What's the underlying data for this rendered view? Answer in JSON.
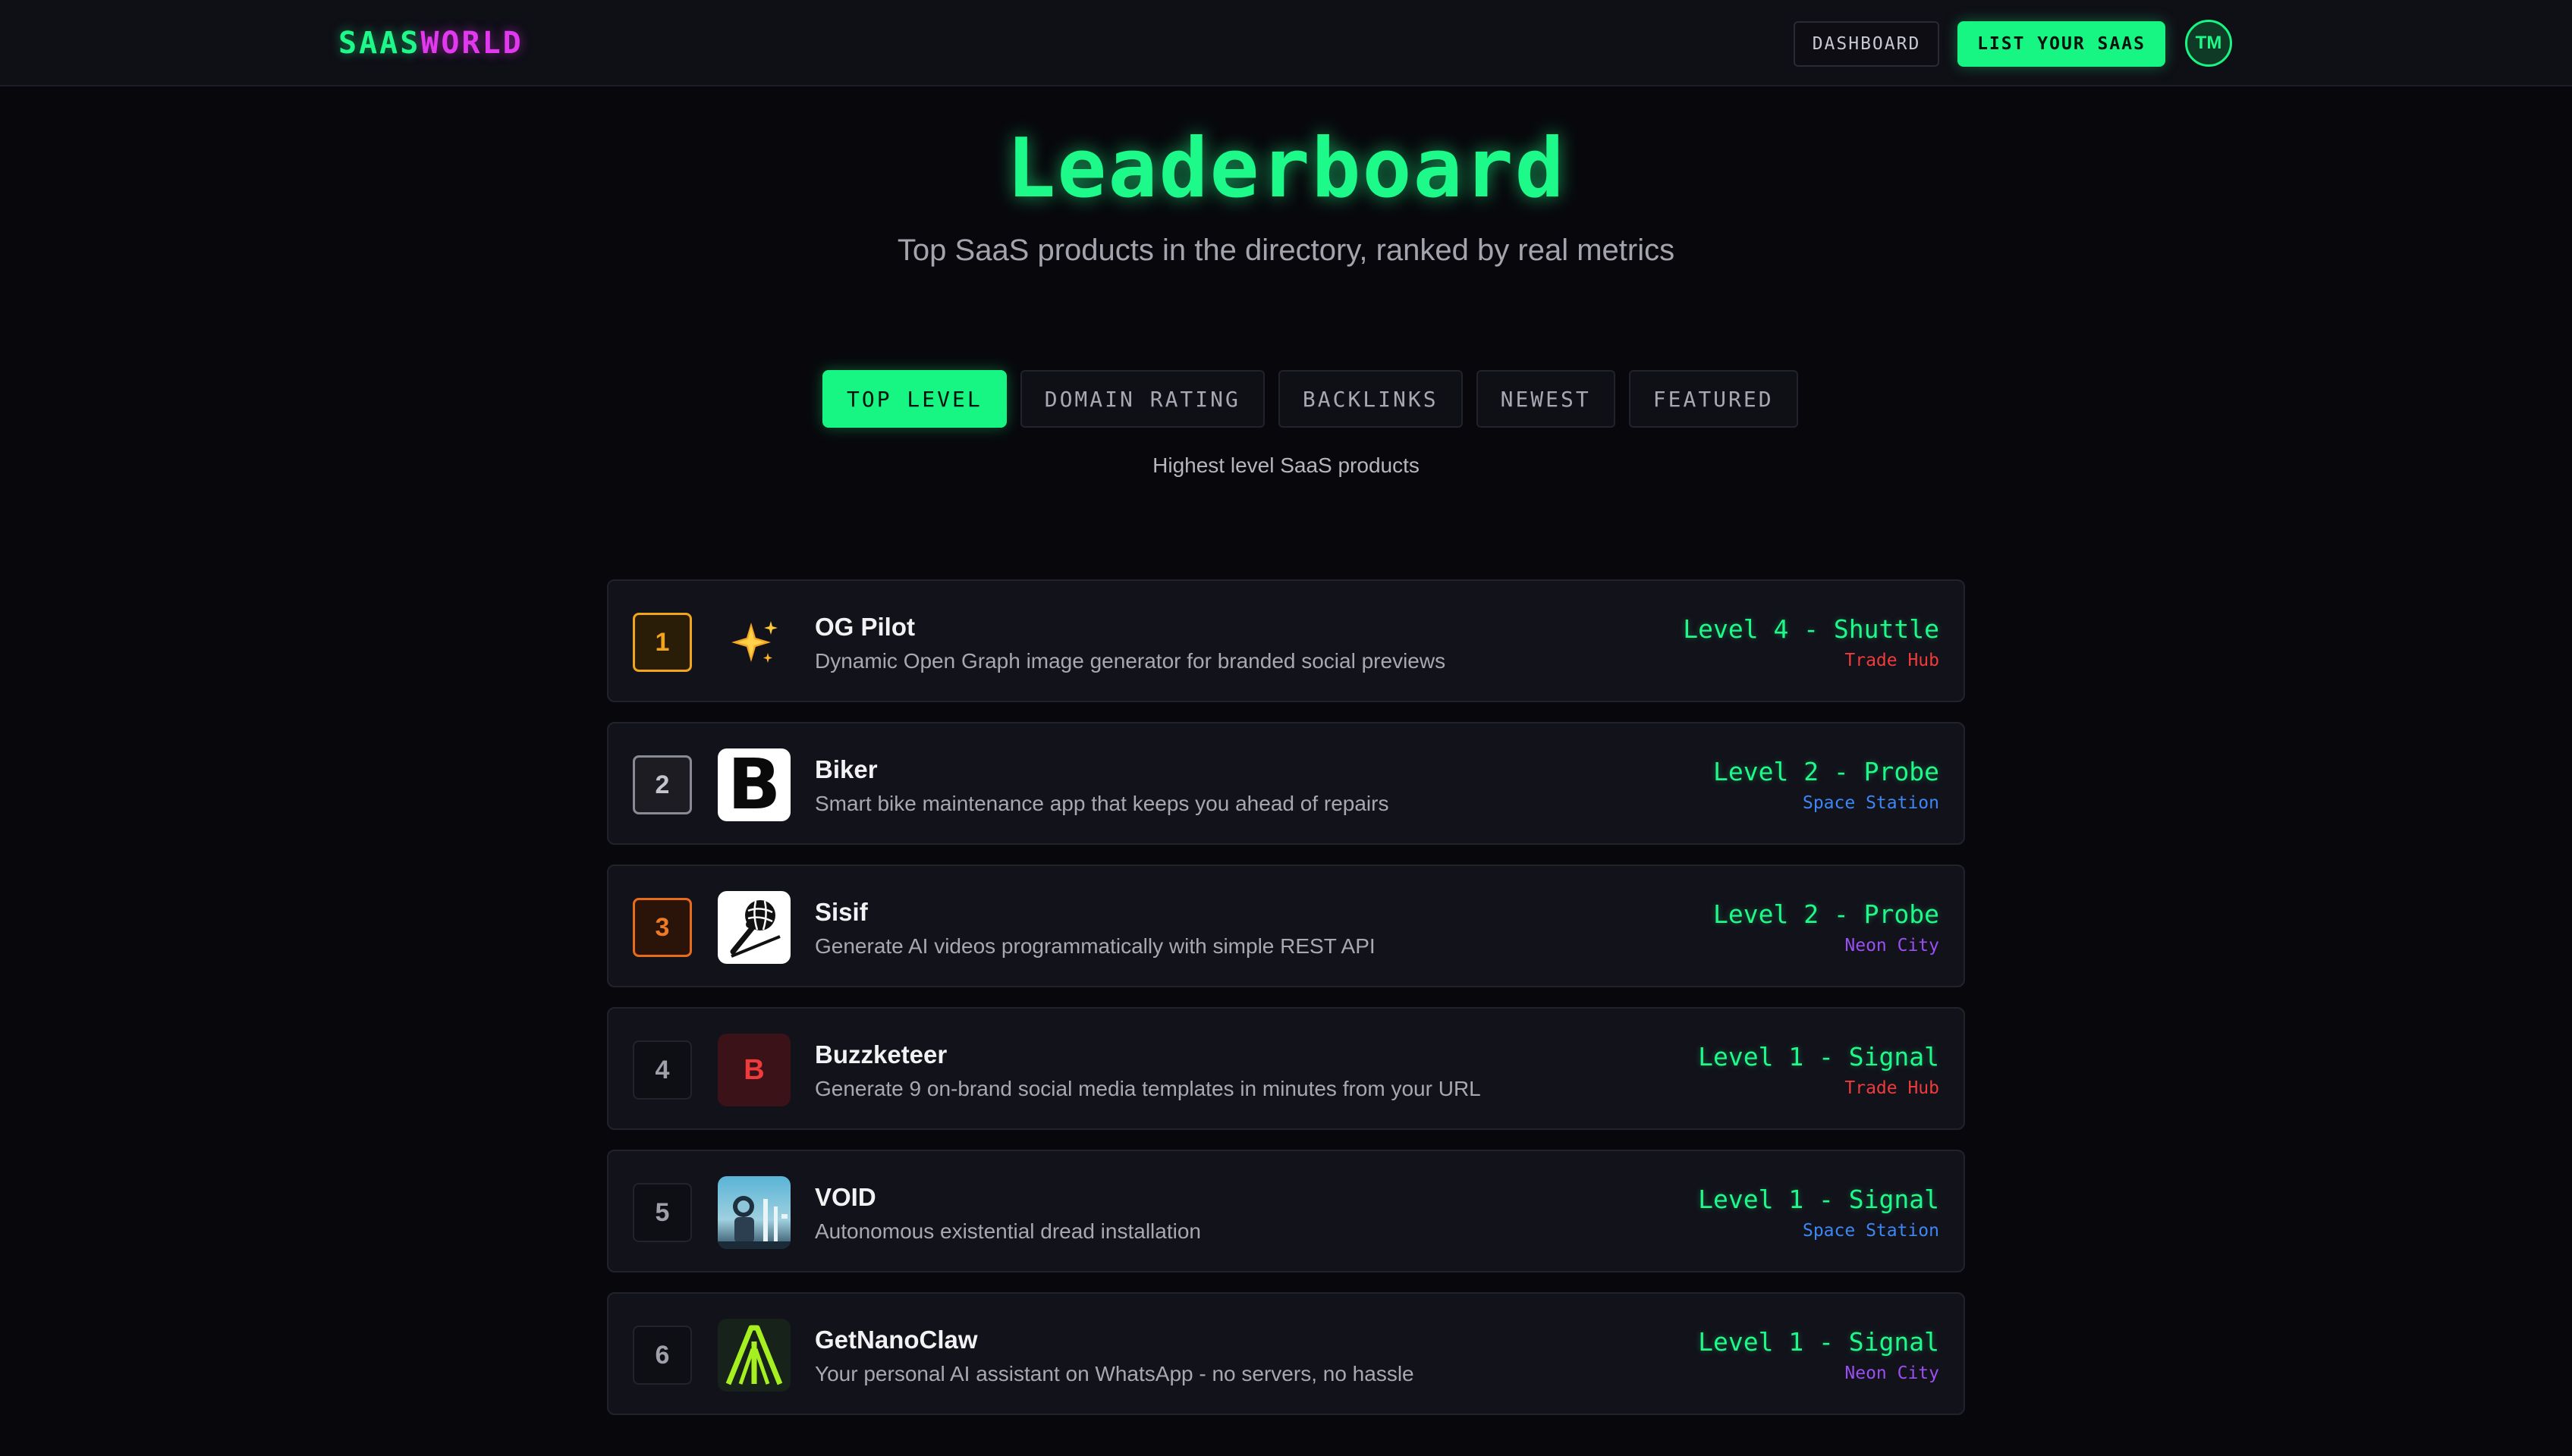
{
  "nav": {
    "brand_part1": "SAAS",
    "brand_part2": "WORLD",
    "dashboard_label": "DASHBOARD",
    "list_label": "LIST YOUR SAAS",
    "avatar_initials": "TM"
  },
  "header": {
    "title": "Leaderboard",
    "subtitle": "Top SaaS products in the directory, ranked by real metrics"
  },
  "tabs": [
    {
      "label": "TOP LEVEL",
      "active": true
    },
    {
      "label": "DOMAIN RATING",
      "active": false
    },
    {
      "label": "BACKLINKS",
      "active": false
    },
    {
      "label": "NEWEST",
      "active": false
    },
    {
      "label": "FEATURED",
      "active": false
    }
  ],
  "tab_description": "Highest level SaaS products",
  "colors": {
    "accent": "#17f582",
    "brand_magenta": "#e238f0",
    "zone_trade_hub": "#ef3b3b",
    "zone_space_station": "#3f86f5",
    "zone_neon_city": "#9a4ff2"
  },
  "products": [
    {
      "rank": "1",
      "name": "OG Pilot",
      "description": "Dynamic Open Graph image generator for branded social previews",
      "level": "Level 4 - Shuttle",
      "zone": "Trade Hub",
      "logo_icon": "sparkles-icon"
    },
    {
      "rank": "2",
      "name": "Biker",
      "description": "Smart bike maintenance app that keeps you ahead of repairs",
      "level": "Level 2 - Probe",
      "zone": "Space Station",
      "logo_icon": "letter-b-logo",
      "logo_letter": "B"
    },
    {
      "rank": "3",
      "name": "Sisif",
      "description": "Generate AI videos programmatically with simple REST API",
      "level": "Level 2 - Probe",
      "zone": "Neon City",
      "logo_icon": "sisyphus-boulder-logo"
    },
    {
      "rank": "4",
      "name": "Buzzketeer",
      "description": "Generate 9 on-brand social media templates in minutes from your URL",
      "level": "Level 1 - Signal",
      "zone": "Trade Hub",
      "logo_icon": "letter-b-logo",
      "logo_letter": "B"
    },
    {
      "rank": "5",
      "name": "VOID",
      "description": "Autonomous existential dread installation",
      "level": "Level 1 - Signal",
      "zone": "Space Station",
      "logo_icon": "void-astronaut-logo"
    },
    {
      "rank": "6",
      "name": "GetNanoClaw",
      "description": "Your personal AI assistant on WhatsApp - no servers, no hassle",
      "level": "Level 1 - Signal",
      "zone": "Neon City",
      "logo_icon": "claw-logo"
    }
  ]
}
